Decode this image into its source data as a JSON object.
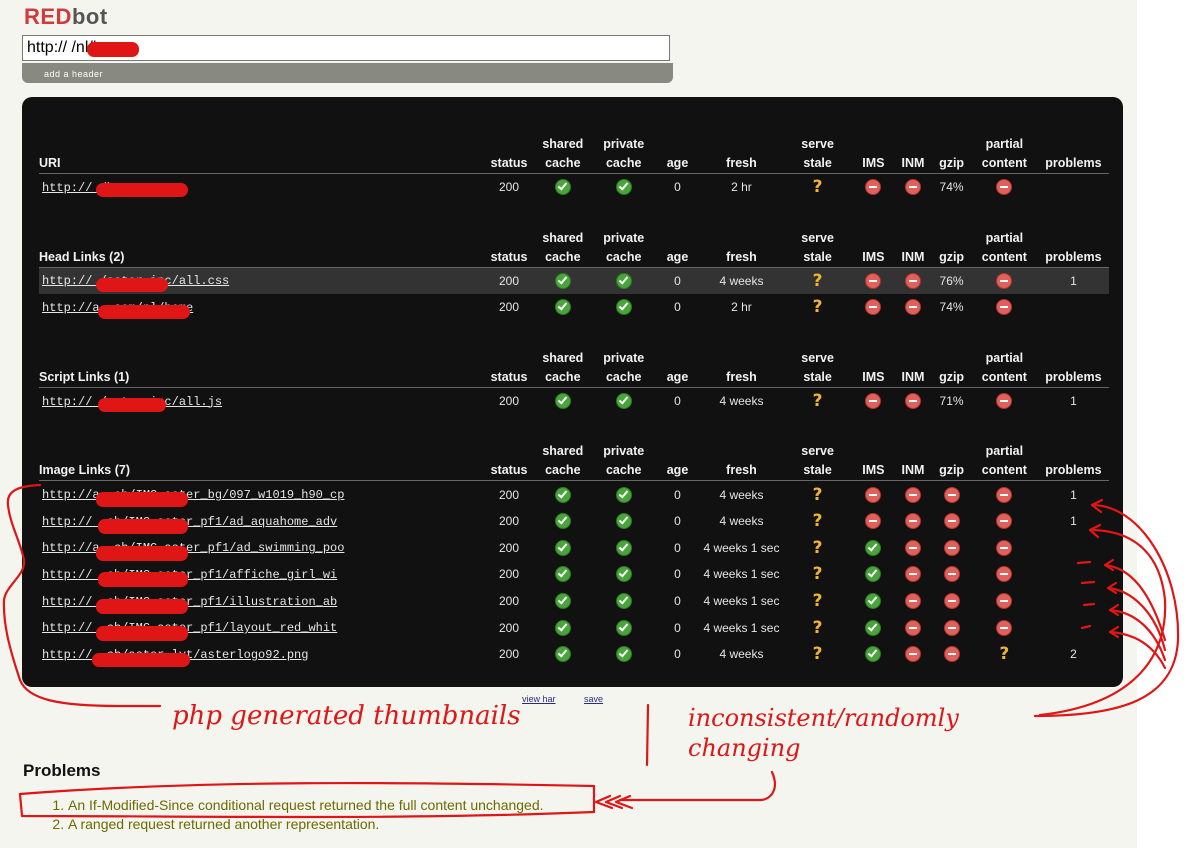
{
  "app": {
    "logo_red": "RED",
    "logo_rest": "bot"
  },
  "uri_input": {
    "value": "http://            /nl/home"
  },
  "add_header": "add a header",
  "columns": [
    "status",
    "shared cache",
    "private cache",
    "age",
    "fresh",
    "serve stale",
    "IMS",
    "INM",
    "gzip",
    "partial content",
    "problems"
  ],
  "sections": [
    {
      "title": "URI",
      "rows": [
        {
          "uri": "http://            /home",
          "status": "200",
          "shared": "ok",
          "private": "ok",
          "age": "0",
          "fresh": "2 hr",
          "stale": "q",
          "ims": "no",
          "inm": "no",
          "gzip": "74%",
          "partial": "no",
          "problems": ""
        }
      ]
    },
    {
      "title": "Head Links (2)",
      "rows": [
        {
          "uri": "http://          /aster_inc/all.css",
          "status": "200",
          "shared": "ok",
          "private": "ok",
          "age": "0",
          "fresh": "4 weeks",
          "stale": "q",
          "ims": "no",
          "inm": "no",
          "gzip": "76%",
          "partial": "no",
          "problems": "1",
          "highlight": true
        },
        {
          "uri": "http://a             .com/nl/home",
          "status": "200",
          "shared": "ok",
          "private": "ok",
          "age": "0",
          "fresh": "2 hr",
          "stale": "q",
          "ims": "no",
          "inm": "no",
          "gzip": "74%",
          "partial": "no",
          "problems": ""
        }
      ]
    },
    {
      "title": "Script Links (1)",
      "rows": [
        {
          "uri": "http://         /aster_inc/all.js",
          "status": "200",
          "shared": "ok",
          "private": "ok",
          "age": "0",
          "fresh": "4 weeks",
          "stale": "q",
          "ims": "no",
          "inm": "no",
          "gzip": "71%",
          "partial": "no",
          "problems": "1"
        }
      ]
    },
    {
      "title": "Image Links (7)",
      "rows": [
        {
          "uri": "http://a            .ch/IMG-aster_bg/097_w1019_h90_cp",
          "status": "200",
          "shared": "ok",
          "private": "ok",
          "age": "0",
          "fresh": "4 weeks",
          "stale": "q",
          "ims": "no",
          "inm": "no",
          "gzip": "no",
          "partial": "no",
          "problems": "1"
        },
        {
          "uri": "http://             .ch/IMG-aster_pf1/ad_aquahome_adv",
          "status": "200",
          "shared": "ok",
          "private": "ok",
          "age": "0",
          "fresh": "4 weeks",
          "stale": "q",
          "ims": "no",
          "inm": "no",
          "gzip": "no",
          "partial": "no",
          "problems": "1"
        },
        {
          "uri": "http://a            .ch/IMG-aster_pf1/ad_swimming_poo",
          "status": "200",
          "shared": "ok",
          "private": "ok",
          "age": "0",
          "fresh": "4 weeks 1 sec",
          "stale": "q",
          "ims": "ok",
          "inm": "no",
          "gzip": "no",
          "partial": "no",
          "problems": ""
        },
        {
          "uri": "http://             .ch/IMG-aster_pf1/affiche_girl_wi",
          "status": "200",
          "shared": "ok",
          "private": "ok",
          "age": "0",
          "fresh": "4 weeks 1 sec",
          "stale": "q",
          "ims": "ok",
          "inm": "no",
          "gzip": "no",
          "partial": "no",
          "problems": ""
        },
        {
          "uri": "http://             .ch/IMG-aster_pf1/illustration_ab",
          "status": "200",
          "shared": "ok",
          "private": "ok",
          "age": "0",
          "fresh": "4 weeks 1 sec",
          "stale": "q",
          "ims": "ok",
          "inm": "no",
          "gzip": "no",
          "partial": "no",
          "problems": ""
        },
        {
          "uri": "http://             .ch/IMG-aster_pf1/layout_red_whit",
          "status": "200",
          "shared": "ok",
          "private": "ok",
          "age": "0",
          "fresh": "4 weeks 1 sec",
          "stale": "q",
          "ims": "ok",
          "inm": "no",
          "gzip": "no",
          "partial": "no",
          "problems": ""
        },
        {
          "uri": "http://              .ch/aster_lyt/asterlogo92.png",
          "status": "200",
          "shared": "ok",
          "private": "ok",
          "age": "0",
          "fresh": "4 weeks",
          "stale": "q",
          "ims": "ok",
          "inm": "no",
          "gzip": "no",
          "partial": "q",
          "problems": "2"
        }
      ]
    }
  ],
  "footer_links": {
    "view_har": "view har",
    "save": "save"
  },
  "problems": {
    "heading": "Problems",
    "items": [
      "An If-Modified-Since conditional request returned the full content unchanged.",
      "A ranged request returned another representation."
    ]
  },
  "annotations": {
    "left": "php generated thumbnails",
    "right_line1": "inconsistent/randomly",
    "right_line2": "changing"
  },
  "colors": {
    "accent_red": "#d13b3b",
    "ok_green": "#4aa43c",
    "no_red": "#e0605c",
    "warn_yellow": "#f2b531",
    "panel": "#111111"
  }
}
